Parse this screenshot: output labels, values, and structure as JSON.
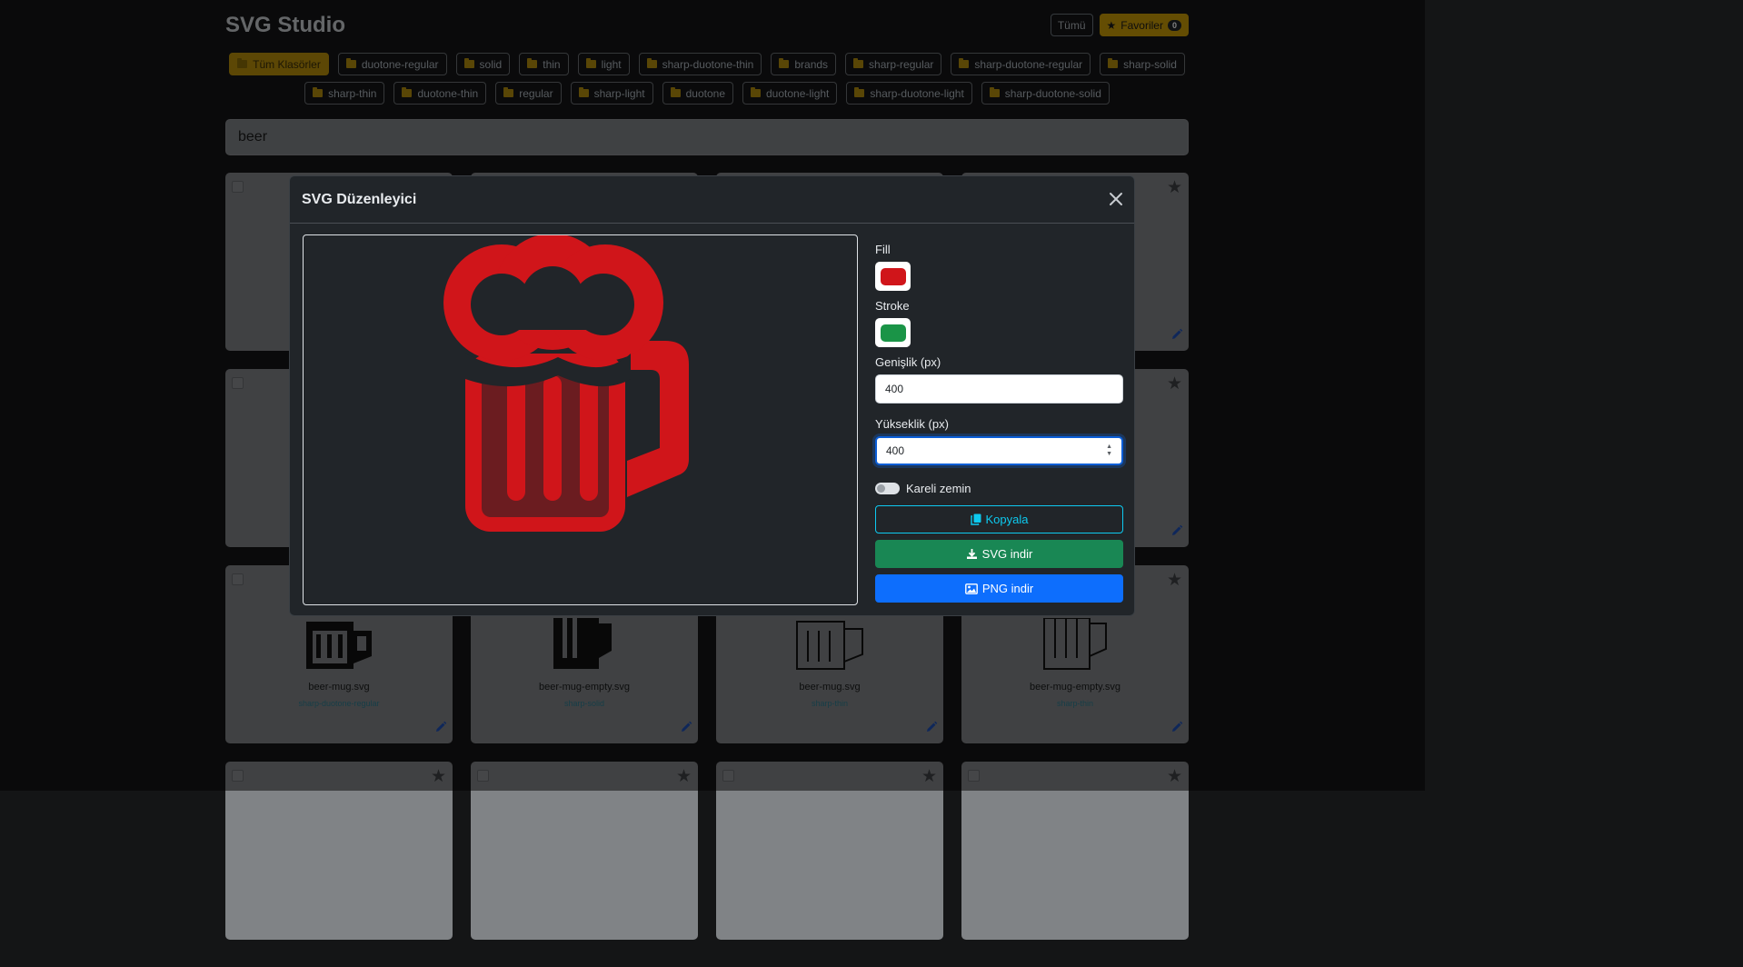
{
  "app": {
    "title": "SVG Studio"
  },
  "header": {
    "all_label": "Tümü",
    "favorites_label": "Favoriler",
    "favorites_count": "0"
  },
  "folders": {
    "row1": [
      {
        "label": "Tüm Klasörler",
        "active": true
      },
      {
        "label": "duotone-regular"
      },
      {
        "label": "solid"
      },
      {
        "label": "thin"
      },
      {
        "label": "light"
      },
      {
        "label": "sharp-duotone-thin"
      },
      {
        "label": "brands"
      },
      {
        "label": "sharp-regular"
      },
      {
        "label": "sharp-duotone-regular"
      },
      {
        "label": "sharp-solid"
      }
    ],
    "row2": [
      {
        "label": "sharp-thin"
      },
      {
        "label": "duotone-thin"
      },
      {
        "label": "regular"
      },
      {
        "label": "sharp-light"
      },
      {
        "label": "duotone"
      },
      {
        "label": "duotone-light"
      },
      {
        "label": "sharp-duotone-light"
      },
      {
        "label": "sharp-duotone-solid"
      }
    ]
  },
  "search": {
    "value": "beer"
  },
  "cards_visible": [
    {
      "name": "beer-mug.svg",
      "folder": "sharp-duotone-regular"
    },
    {
      "name": "beer-mug-empty.svg",
      "folder": "sharp-solid"
    },
    {
      "name": "beer-mug.svg",
      "folder": "sharp-thin"
    },
    {
      "name": "beer-mug-empty.svg",
      "folder": "sharp-thin"
    }
  ],
  "modal": {
    "title": "SVG Düzenleyici",
    "fill_label": "Fill",
    "fill_color": "#d0151a",
    "stroke_label": "Stroke",
    "stroke_color": "#1a9447",
    "width_label": "Genişlik (px)",
    "width_value": "400",
    "height_label": "Yükseklik (px)",
    "height_value": "400",
    "checker_label": "Kareli zemin",
    "checker_on": false,
    "copy_label": "Kopyala",
    "svg_download_label": "SVG indir",
    "png_download_label": "PNG indir"
  },
  "colors": {
    "accent_yellow": "#c99a07",
    "copy_cyan": "#0dcaf0",
    "svg_green": "#198754",
    "png_blue": "#0d6efd",
    "mug_fill": "#d0151a",
    "mug_inner": "#6b1c20"
  }
}
